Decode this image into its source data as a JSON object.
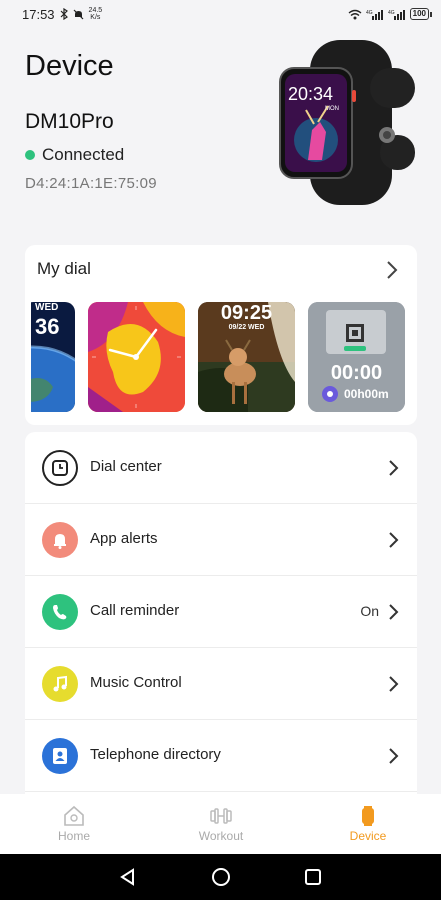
{
  "status_bar": {
    "time": "17:53",
    "speed_value": "24.5",
    "speed_unit": "K/s",
    "battery": "100"
  },
  "header": {
    "title": "Device",
    "device_name": "DM10Pro",
    "connection_status": "Connected",
    "mac_address": "D4:24:1A:1E:75:09"
  },
  "watch_preview": {
    "time": "20:34",
    "day": "MON"
  },
  "my_dial": {
    "title": "My dial",
    "faces": [
      {
        "name": "earth-face",
        "text_top": "WED",
        "text_big": "36"
      },
      {
        "name": "analog-face"
      },
      {
        "name": "deer-face",
        "time": "09:25",
        "date": "09/22 WED"
      },
      {
        "name": "timer-face",
        "time": "00:00",
        "sub": "00h00m"
      }
    ]
  },
  "menu": [
    {
      "label": "Dial center",
      "value": "",
      "icon": "watch-icon"
    },
    {
      "label": "App alerts",
      "value": "",
      "icon": "bell-icon"
    },
    {
      "label": "Call reminder",
      "value": "On",
      "icon": "phone-icon"
    },
    {
      "label": "Music Control",
      "value": "",
      "icon": "music-note-icon"
    },
    {
      "label": "Telephone directory",
      "value": "",
      "icon": "contacts-icon"
    }
  ],
  "tabs": [
    {
      "label": "Home",
      "icon": "home-icon"
    },
    {
      "label": "Workout",
      "icon": "dumbbell-icon"
    },
    {
      "label": "Device",
      "icon": "device-icon"
    }
  ],
  "colors": {
    "accent": "#f29a1f",
    "connected": "#2ec27e",
    "dial_center": "#222222",
    "app_alerts": "#f28b7b",
    "call_reminder": "#2ec27e",
    "music_control": "#e6dc2e",
    "telephone_directory": "#2b72d8"
  }
}
